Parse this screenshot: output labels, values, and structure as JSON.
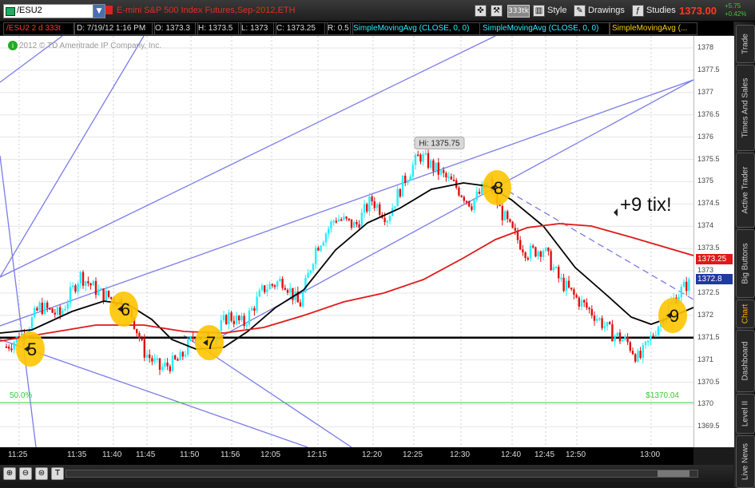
{
  "toolbar": {
    "symbol": "/ESU2",
    "description": "E-mini S&P 500 Index Futures,Sep-2012,ETH",
    "aggregation": "333tk",
    "style_label": "Style",
    "drawings_label": "Drawings",
    "studies_label": "Studies",
    "last_price": "1373.00",
    "change_abs": "+5.75",
    "change_pct": "+0.42%"
  },
  "infobar": {
    "symbol_period": "/ESU2 2 d 333t",
    "date": "D: 7/19/12 1:16 PM",
    "open": "O: 1373.3",
    "high": "H: 1373.5",
    "low": "L: 1373",
    "close": "C: 1373.25",
    "range": "R: 0.5",
    "sma1": "SimpleMovingAvg (CLOSE, 0, 0)",
    "sma2": "SimpleMovingAvg (CLOSE, 0, 0)",
    "sma3": "SimpleMovingAvg (..."
  },
  "chart": {
    "copyright": "2012 © TD Ameritrade IP Company, Inc.",
    "hi_label": "Hi: 1375.75",
    "annotation": "+9 tix!",
    "fib_label": "50.0%",
    "fib_price": "$1370.04",
    "wave_labels": [
      "5",
      "6",
      "7",
      "8",
      "9"
    ],
    "red_ma_badge": "1373.25",
    "blue_price_badge": "1372.8",
    "colors": {
      "up_candle": "#20f0ff",
      "down_candle": "#e01010",
      "black_ma": "#000000",
      "red_ma": "#e01818",
      "channel": "#7b7bea",
      "marker": "#ffc400",
      "fib": "#33cc33"
    }
  },
  "chart_data": {
    "type": "candlestick",
    "y_ticks": [
      "1378",
      "1377.5",
      "1377",
      "1376.5",
      "1376",
      "1375.5",
      "1375",
      "1374.5",
      "1374",
      "1373.5",
      "1373",
      "1372.5",
      "1372",
      "1371.5",
      "1371",
      "1370.5",
      "1370",
      "1369.5"
    ],
    "x_ticks": [
      "11:25",
      "11:35",
      "11:40",
      "11:45",
      "11:50",
      "11:56",
      "12:05",
      "12:15",
      "12:20",
      "12:25",
      "12:30",
      "12:40",
      "12:45",
      "12:50",
      "13:00"
    ],
    "ylim": [
      1369.25,
      1378.25
    ],
    "horizontal_line": 1371.5,
    "fib_50": 1370.04,
    "high": 1375.75
  },
  "sidetabs": [
    "Trade",
    "Times And Sales",
    "Active Trader",
    "Big Buttons",
    "Chart",
    "Dashboard",
    "Level II",
    "Live News"
  ]
}
